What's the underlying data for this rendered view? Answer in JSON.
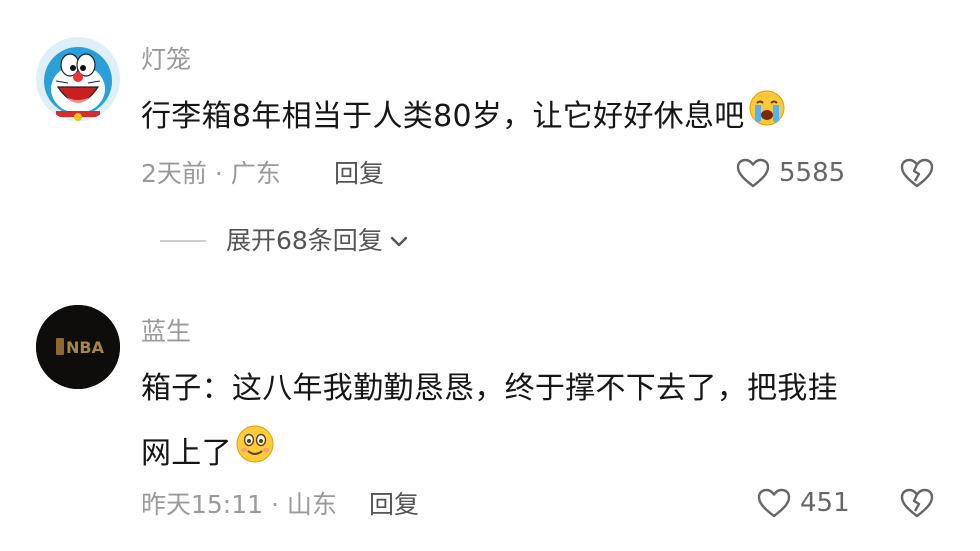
{
  "comments": [
    {
      "username": "灯笼",
      "text": "行李箱8年相当于人类80岁，让它好好休息吧",
      "emoji": "crying-face-icon",
      "meta": "2天前 · 广东",
      "reply_label": "回复",
      "likes": "5585"
    },
    {
      "username": "蓝生",
      "avatar_text": "NBA",
      "text_line1": "箱子：这八年我勤勤恳恳，终于撑不下去了，把我挂",
      "text_line2": "网上了",
      "emoji": "smiling-face-icon",
      "meta": "昨天15:11 · 山东",
      "reply_label": "回复",
      "likes": "451"
    }
  ],
  "expand_replies": {
    "label": "展开68条回复"
  },
  "colors": {
    "text": "#161616",
    "secondary": "#9a9a9a",
    "icon": "#666666"
  }
}
